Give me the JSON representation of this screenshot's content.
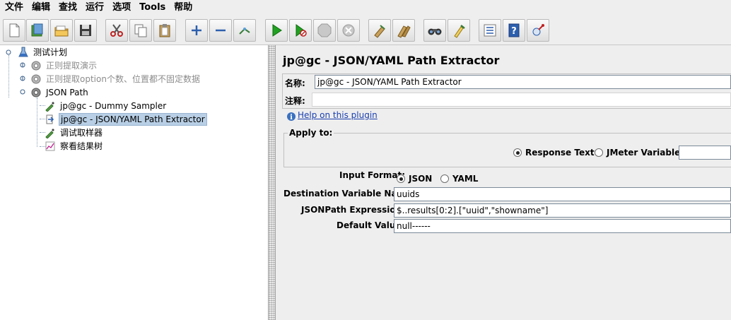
{
  "menu": [
    "文件",
    "编辑",
    "查找",
    "运行",
    "选项",
    "Tools",
    "帮助"
  ],
  "toolbar_icons": [
    "new-icon",
    "templates-icon",
    "open-icon",
    "save-icon",
    "cut-icon",
    "copy-icon",
    "paste-icon",
    "expand-icon",
    "collapse-icon",
    "toggle-icon",
    "start-icon",
    "start-no-timers-icon",
    "stop-icon",
    "shutdown-icon",
    "clear-icon",
    "clear-all-icon",
    "search-icon",
    "reset-search-icon",
    "function-helper-icon",
    "help-icon",
    "remote-icon"
  ],
  "tree": {
    "root": "测试计划",
    "items": [
      {
        "label": "正则提取演示",
        "disabled": true
      },
      {
        "label": "正则提取option个数、位置都不固定数据",
        "disabled": true
      },
      {
        "label": "JSON Path",
        "disabled": false
      }
    ],
    "children": [
      {
        "label": "jp@gc - Dummy Sampler"
      },
      {
        "label": "jp@gc - JSON/YAML Path Extractor",
        "selected": true
      },
      {
        "label": "调试取样器"
      },
      {
        "label": "察看结果树"
      }
    ]
  },
  "panel": {
    "title": "jp@gc - JSON/YAML Path Extractor",
    "name_label": "名称:",
    "name_value": "jp@gc - JSON/YAML Path Extractor",
    "comment_label": "注释:",
    "comment_value": "",
    "help_link": "Help on this plugin",
    "apply_to": {
      "legend": "Apply to:",
      "option_response": "Response Text",
      "option_variable": "JMeter Variable:",
      "variable_value": ""
    },
    "input_format": {
      "label": "Input Format:",
      "option_json": "JSON",
      "option_yaml": "YAML",
      "selected": "JSON"
    },
    "dest_var": {
      "label": "Destination Variable Name:",
      "value": "uuids"
    },
    "jsonpath": {
      "label": "JSONPath Expression:",
      "value": "$..results[0:2].[\"uuid\",\"showname\"]"
    },
    "default_value": {
      "label": "Default Value:",
      "value": "null------"
    }
  }
}
